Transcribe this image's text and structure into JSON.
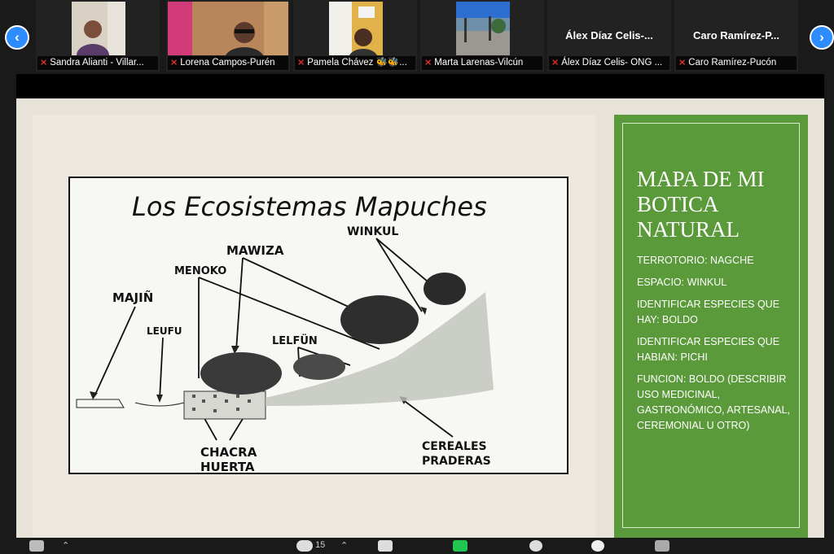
{
  "participants": [
    {
      "name": "Sandra Alianti - Villar...",
      "has_video": true
    },
    {
      "name": "Lorena Campos-Purén",
      "has_video": true
    },
    {
      "name": "Pamela Chávez 🐝🐝...",
      "has_video": true
    },
    {
      "name": "Marta Larenas-Vilcún",
      "has_video": true
    },
    {
      "name": "Álex Díaz Celis- ONG ...",
      "display": "Álex Díaz Celis-...",
      "has_video": false
    },
    {
      "name": "Caro Ramírez-Pucón",
      "display": "Caro  Ramírez-P...",
      "has_video": false
    }
  ],
  "nav": {
    "prev_glyph": "‹",
    "next_glyph": "›"
  },
  "sketch": {
    "title": "Los Ecosistemas Mapuches",
    "labels": {
      "majin": "MAJIÑ",
      "leufu": "LEUFU",
      "menoko": "MENOKO",
      "mawiza": "MAWIZA",
      "winkul": "WINKUL",
      "lelfun": "LELFÜN",
      "chacra": "CHACRA",
      "huerta": "HUERTA",
      "cereales": "CEREALES",
      "praderas": "PRADERAS"
    }
  },
  "panel": {
    "title": "MAPA DE MI BOTICA NATURAL",
    "lines": [
      "TERROTORIO: NAGCHE",
      "ESPACIO: WINKUL",
      "IDENTIFICAR ESPECIES QUE HAY: BOLDO",
      "IDENTIFICAR ESPECIES QUE HABIAN: PICHI",
      "FUNCION: BOLDO (DESCRIBIR USO MEDICINAL, GASTRONÓMICO, ARTESANAL,  CEREMONIAL U OTRO)"
    ]
  },
  "toolbar": {
    "participants_count": "15"
  },
  "colors": {
    "accent": "#2d8cff",
    "panel_green": "#5a9a3a",
    "mic_off": "#e0312e"
  }
}
